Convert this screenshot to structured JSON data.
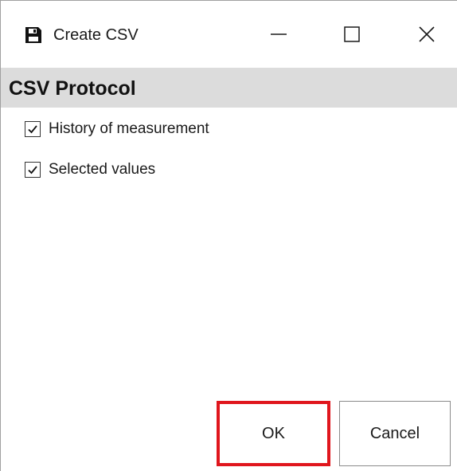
{
  "window": {
    "title": "Create CSV",
    "icon": "save-icon",
    "controls": {
      "minimize_icon": "minimize-icon",
      "maximize_icon": "maximize-icon",
      "close_icon": "close-icon"
    }
  },
  "section": {
    "title": "CSV Protocol"
  },
  "options": [
    {
      "label": "History of measurement",
      "checked": true
    },
    {
      "label": "Selected values",
      "checked": true
    }
  ],
  "buttons": {
    "ok_label": "OK",
    "cancel_label": "Cancel"
  },
  "colors": {
    "header_bg": "#dcdcdc",
    "highlight": "#e0161d"
  }
}
